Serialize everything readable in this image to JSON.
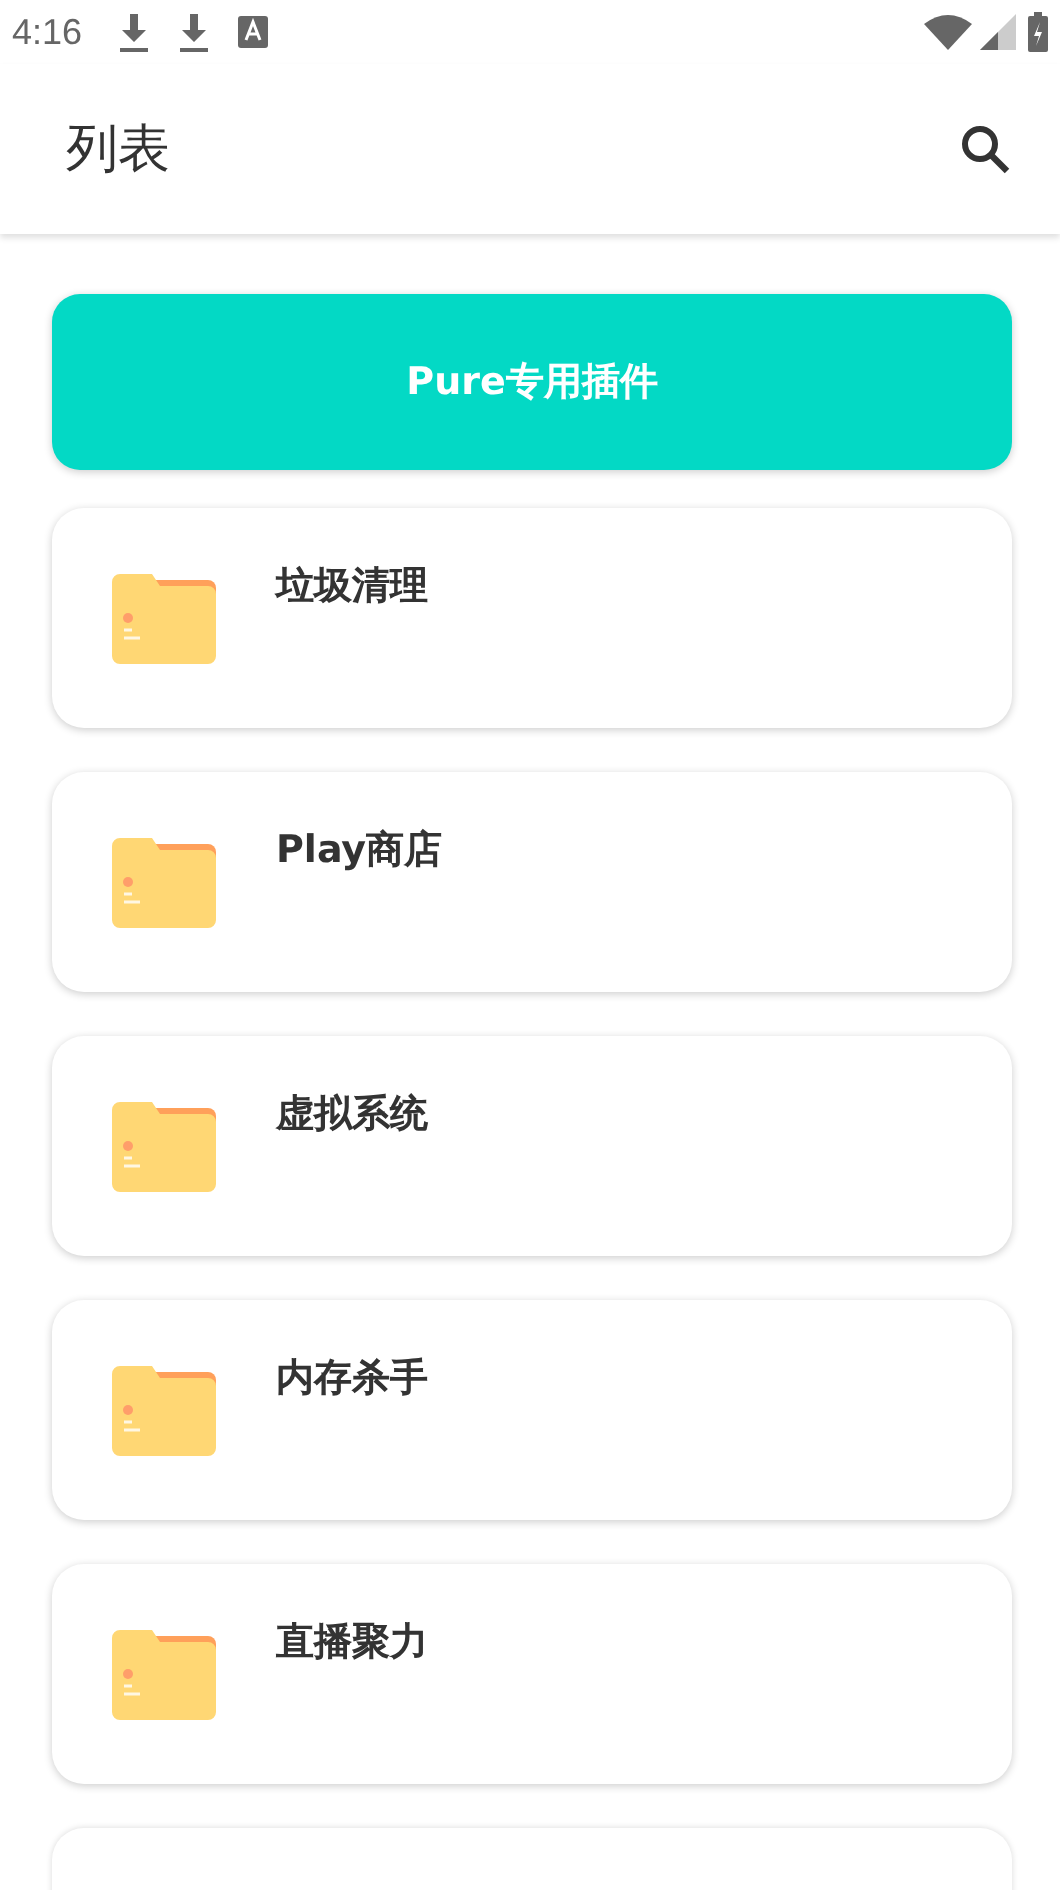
{
  "status_bar": {
    "time": "4:16"
  },
  "app_bar": {
    "title": "列表"
  },
  "header_button": {
    "label": "Pure专用插件"
  },
  "items": [
    {
      "title": "垃圾清理"
    },
    {
      "title": "Play商店"
    },
    {
      "title": "虚拟系统"
    },
    {
      "title": "内存杀手"
    },
    {
      "title": "直播聚力"
    }
  ]
}
